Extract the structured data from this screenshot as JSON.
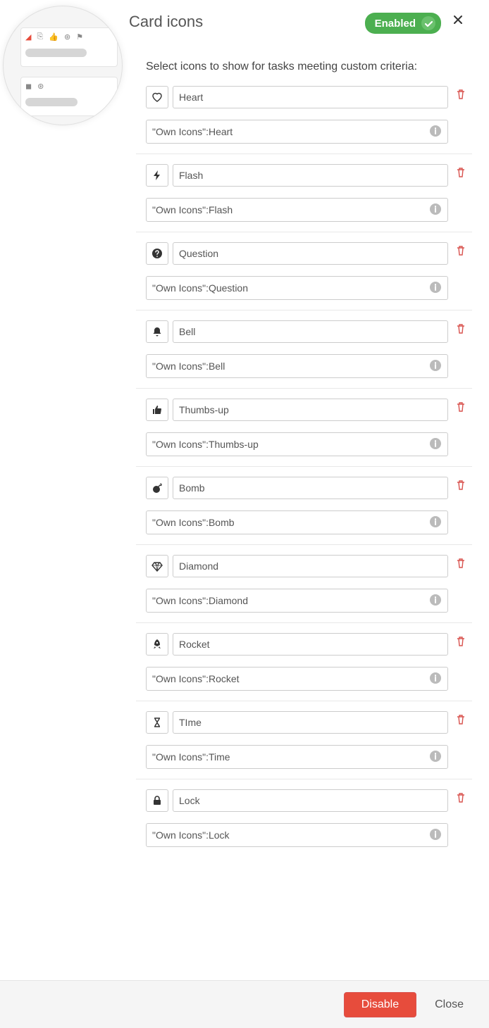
{
  "header": {
    "title": "Card icons",
    "status_label": "Enabled"
  },
  "intro": "Select icons to show for tasks meeting custom criteria:",
  "rules": [
    {
      "icon": "heart-icon",
      "name": "Heart",
      "criteria": "\"Own Icons\":Heart"
    },
    {
      "icon": "flash-icon",
      "name": "Flash",
      "criteria": "\"Own Icons\":Flash"
    },
    {
      "icon": "question-icon",
      "name": "Question",
      "criteria": "\"Own Icons\":Question"
    },
    {
      "icon": "bell-icon",
      "name": "Bell",
      "criteria": "\"Own Icons\":Bell"
    },
    {
      "icon": "thumbs-up-icon",
      "name": "Thumbs-up",
      "criteria": "\"Own Icons\":Thumbs-up"
    },
    {
      "icon": "bomb-icon",
      "name": "Bomb",
      "criteria": "\"Own Icons\":Bomb"
    },
    {
      "icon": "diamond-icon",
      "name": "Diamond",
      "criteria": "\"Own Icons\":Diamond"
    },
    {
      "icon": "rocket-icon",
      "name": "Rocket",
      "criteria": "\"Own Icons\":Rocket"
    },
    {
      "icon": "hourglass-icon",
      "name": "TIme",
      "criteria": "\"Own Icons\":Time"
    },
    {
      "icon": "lock-icon",
      "name": "Lock",
      "criteria": "\"Own Icons\":Lock"
    }
  ],
  "footer": {
    "disable_label": "Disable",
    "close_label": "Close"
  }
}
